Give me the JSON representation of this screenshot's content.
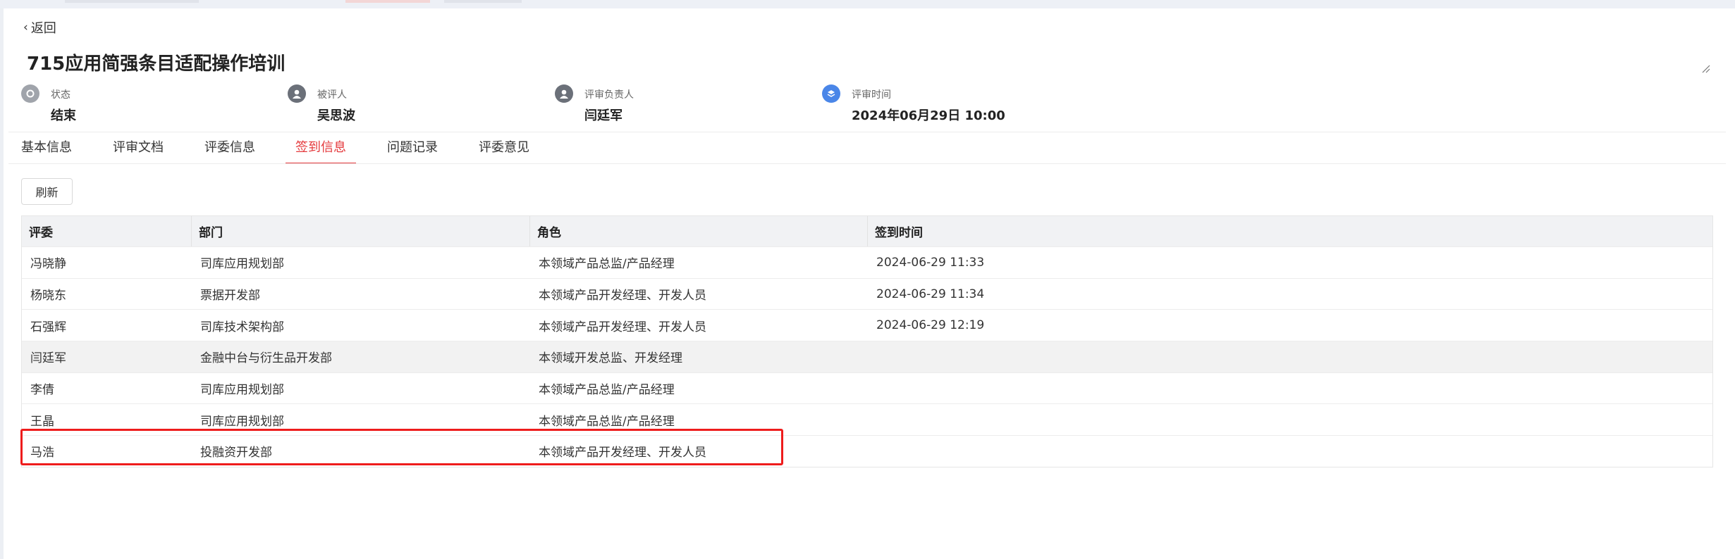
{
  "nav": {
    "back_label": "返回"
  },
  "page": {
    "title": "715应用简强条目适配操作培训"
  },
  "info": [
    {
      "label": "状态",
      "value": "结束",
      "icon": "status-icon"
    },
    {
      "label": "被评人",
      "value": "吴思波",
      "icon": "user-icon"
    },
    {
      "label": "评审负责人",
      "value": "闫廷军",
      "icon": "user-icon"
    },
    {
      "label": "评审时间",
      "value": "2024年06月29日 10:00",
      "icon": "layers-icon"
    }
  ],
  "tabs": [
    "基本信息",
    "评审文档",
    "评委信息",
    "签到信息",
    "问题记录",
    "评委意见"
  ],
  "active_tab": "签到信息",
  "toolbar": {
    "refresh_label": "刷新"
  },
  "table": {
    "columns": [
      "评委",
      "部门",
      "角色",
      "签到时间"
    ],
    "rows": [
      [
        "冯晓静",
        "司库应用规划部",
        "本领域产品总监/产品经理",
        "2024-06-29 11:33"
      ],
      [
        "杨晓东",
        "票据开发部",
        "本领域产品开发经理、开发人员",
        "2024-06-29 11:34"
      ],
      [
        "石强辉",
        "司库技术架构部",
        "本领域产品开发经理、开发人员",
        "2024-06-29 12:19"
      ],
      [
        "闫廷军",
        "金融中台与衍生品开发部",
        "本领域开发总监、开发经理",
        ""
      ],
      [
        "李倩",
        "司库应用规划部",
        "本领域产品总监/产品经理",
        ""
      ],
      [
        "王晶",
        "司库应用规划部",
        "本领域产品总监/产品经理",
        ""
      ],
      [
        "马浩",
        "投融资开发部",
        "本领域产品开发经理、开发人员",
        ""
      ]
    ]
  },
  "colors": {
    "accent": "#e4393c",
    "highlight": "#ee1c1c",
    "status_icon": "#a0a4ab",
    "user_icon": "#6b7079",
    "time_icon": "#4a86e8"
  }
}
